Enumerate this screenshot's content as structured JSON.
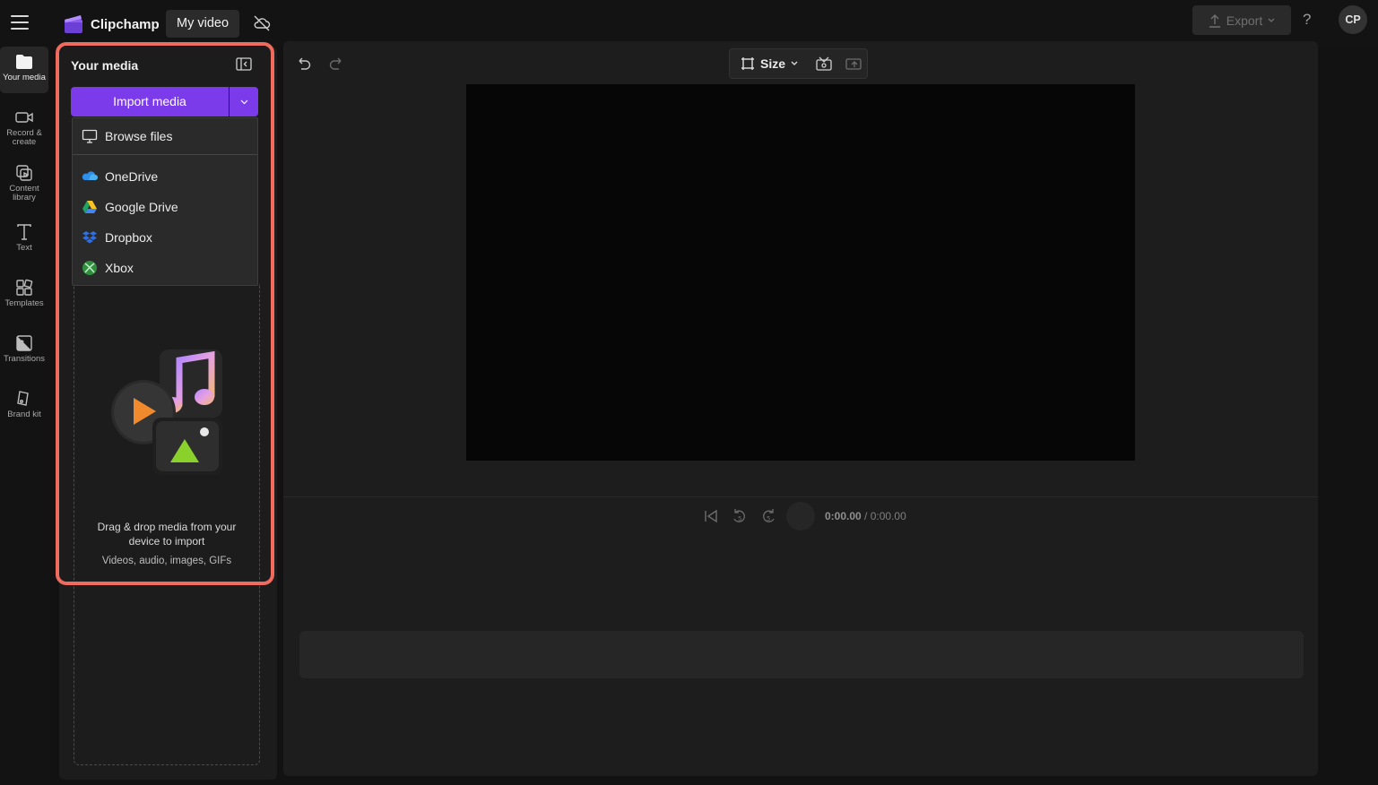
{
  "app": {
    "name": "Clipchamp",
    "project_name": "My video",
    "export_label": "Export",
    "help_symbol": "?",
    "avatar_initials": "CP"
  },
  "nav": {
    "items": [
      {
        "label": "Your media",
        "icon": "folder-icon",
        "active": true
      },
      {
        "label": "Record & create",
        "icon": "video-camera-icon"
      },
      {
        "label": "Content library",
        "icon": "library-icon"
      },
      {
        "label": "Text",
        "icon": "text-icon"
      },
      {
        "label": "Templates",
        "icon": "templates-icon"
      },
      {
        "label": "Transitions",
        "icon": "transitions-icon"
      },
      {
        "label": "Brand kit",
        "icon": "brand-kit-icon"
      }
    ]
  },
  "media_panel": {
    "title": "Your media",
    "import_label": "Import media",
    "menu": [
      {
        "label": "Browse files",
        "icon": "monitor-icon"
      },
      {
        "label": "OneDrive",
        "icon": "onedrive-icon"
      },
      {
        "label": "Google Drive",
        "icon": "google-drive-icon"
      },
      {
        "label": "Dropbox",
        "icon": "dropbox-icon"
      },
      {
        "label": "Xbox",
        "icon": "xbox-icon"
      }
    ],
    "drop_title": "Drag & drop media from your device to import",
    "drop_types": "Videos, audio, images, GIFs"
  },
  "editor": {
    "size_label": "Size",
    "time_current": "0:00.00",
    "time_separator": " / ",
    "time_total": "0:00.00"
  },
  "colors": {
    "accent": "#7b3bea",
    "highlight": "#ee6b5e",
    "background": "#121212"
  }
}
